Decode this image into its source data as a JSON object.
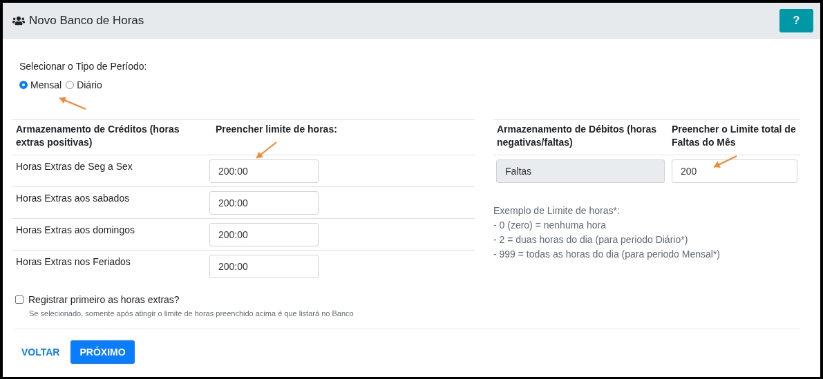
{
  "header": {
    "title": "Novo Banco de Horas",
    "help_button": "?"
  },
  "period": {
    "label": "Selecionar o Tipo de Período:",
    "options": [
      {
        "label": "Mensal",
        "selected": true
      },
      {
        "label": "Diário",
        "selected": false
      }
    ]
  },
  "credits": {
    "columns": [
      "Armazenamento de Créditos (horas extras positivas)",
      "Preencher limite de horas:"
    ],
    "rows": [
      {
        "label": "Horas Extras de Seg a Sex",
        "value": "200:00"
      },
      {
        "label": "Horas Extras aos sabados",
        "value": "200:00"
      },
      {
        "label": "Horas Extras aos domingos",
        "value": "200:00"
      },
      {
        "label": "Horas Extras nos Feriados",
        "value": "200:00"
      }
    ]
  },
  "debits": {
    "columns": [
      "Armazenamento de Débitos (horas negativas/faltas)",
      "Preencher o Limite total de Faltas do Mês"
    ],
    "rows": [
      {
        "label": "Faltas",
        "value": "200"
      }
    ]
  },
  "example": {
    "title": "Exemplo de Limite de horas*:",
    "lines": [
      "- 0 (zero) = nenhuma hora",
      "- 2 = duas horas do dia (para periodo Diário*)",
      "- 999 = todas as horas do dia (para periodo Mensal*)"
    ]
  },
  "register_first": {
    "label": "Registrar primeiro as horas extras?",
    "checked": false,
    "hint": "Se selecionado, somente após atingir o limite de horas preenchido acima é que listará no Banco"
  },
  "buttons": [
    {
      "label": "VOLTAR",
      "kind": "link"
    },
    {
      "label": "PRÓXIMO",
      "kind": "primary"
    }
  ]
}
